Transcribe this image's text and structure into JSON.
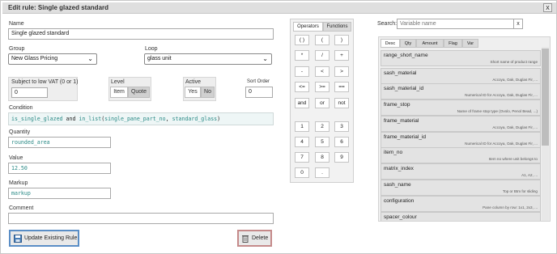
{
  "window": {
    "title": "Edit rule: Single glazed standard",
    "close_label": "x"
  },
  "form": {
    "name_label": "Name",
    "name_value": "Single glazed standard",
    "group_label": "Group",
    "group_value": "New Glass Pricing",
    "loop_label": "Loop",
    "loop_value": "glass unit",
    "vat_label": "Subject to low VAT (0 or 1)",
    "vat_value": "0",
    "level_label": "Level",
    "level_options": [
      "Item",
      "Quote"
    ],
    "level_selected": "Quote",
    "active_label": "Active",
    "active_options": [
      "Yes",
      "No"
    ],
    "active_selected": "No",
    "sort_label": "Sort Order",
    "sort_value": "0",
    "condition_label": "Condition",
    "condition_parts": [
      "is_single_glazed",
      " and ",
      "in_list",
      "(",
      "single_pane_part_no",
      ", ",
      "standard_glass",
      ")"
    ],
    "quantity_label": "Quantity",
    "quantity_value": "rounded_area",
    "value_label": "Value",
    "value_value": "12.50",
    "markup_label": "Markup",
    "markup_value": "markup",
    "comment_label": "Comment",
    "comment_value": ""
  },
  "buttons": {
    "update_label": "Update Existing Rule",
    "delete_label": "Delete"
  },
  "calculator": {
    "tabs": [
      "Operators",
      "Functions"
    ],
    "active_tab": "Operators",
    "keys": [
      [
        "(",
        ")"
      ],
      [
        "(",
        ")"
      ],
      [
        ")",
        ")"
      ]
    ],
    "key_rows": [
      [
        "( )",
        "(",
        ")"
      ],
      [
        "*",
        "/",
        "+"
      ],
      [
        "-",
        "<",
        ">"
      ],
      [
        "<=",
        ">=",
        "=="
      ],
      [
        "and",
        "or",
        "not"
      ],
      [
        "1",
        "2",
        "3"
      ],
      [
        "4",
        "5",
        "6"
      ],
      [
        "7",
        "8",
        "9"
      ],
      [
        "0",
        "."
      ]
    ]
  },
  "variables": {
    "search_label": "Search:",
    "search_placeholder": "Variable name",
    "search_clear": "x",
    "tabs": [
      "Desc",
      "Qty",
      "Amount",
      "Flag",
      "Var"
    ],
    "active_tab": "Desc",
    "items": [
      {
        "name": "range_short_name",
        "desc": "Short name of product range"
      },
      {
        "name": "sash_material",
        "desc": "Accoya, Oak, Duglas Fir, ..."
      },
      {
        "name": "sash_material_id",
        "desc": "Numerical ID for Accoya, Oak, Duglas Fir, ..."
      },
      {
        "name": "frame_stop",
        "desc": "Name of frame stop type (Ovolo, Penol Bead, ...)"
      },
      {
        "name": "frame_material",
        "desc": "Accoya, Oak, Duglas Fir, ..."
      },
      {
        "name": "frame_material_id",
        "desc": "Numerical ID for Accoya, Oak, Duglas Fir, ..."
      },
      {
        "name": "item_no",
        "desc": "Item no where unit belongs to"
      },
      {
        "name": "matrix_index",
        "desc": "A1, A2, ..."
      },
      {
        "name": "sash_name",
        "desc": "Top or Btm for sliding"
      },
      {
        "name": "configuration",
        "desc": "Pane column by row: 1x1, 2x3, ..."
      },
      {
        "name": "spacer_colour",
        "desc": ""
      }
    ]
  },
  "colors": {
    "accent_update": "#5a8ec6",
    "accent_delete": "#c58a8a",
    "code_teal": "#2a8a86"
  }
}
